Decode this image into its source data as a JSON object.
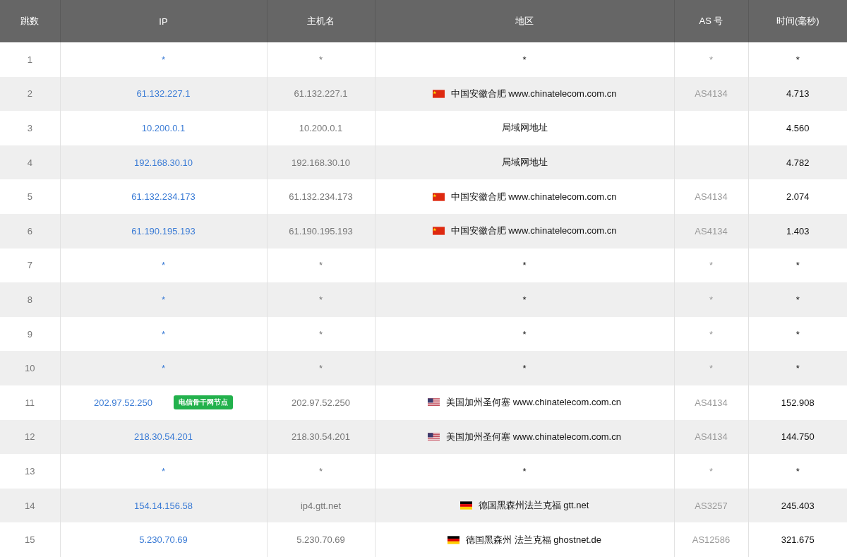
{
  "table": {
    "columns": [
      "跳数",
      "IP",
      "主机名",
      "地区",
      "AS 号",
      "时间(毫秒)"
    ],
    "rows": [
      {
        "hop": "1",
        "ip": "*",
        "host": "*",
        "region": "*",
        "as": "*",
        "time": "*"
      },
      {
        "hop": "2",
        "ip": "61.132.227.1",
        "host": "61.132.227.1",
        "kind": "cn",
        "region": "中国安徽合肥 www.chinatelecom.com.cn",
        "as": "AS4134",
        "time": "4.713"
      },
      {
        "hop": "3",
        "ip": "10.200.0.1",
        "host": "10.200.0.1",
        "region": "局域网地址",
        "time": "4.560"
      },
      {
        "hop": "4",
        "ip": "192.168.30.10",
        "host": "192.168.30.10",
        "region": "局域网地址",
        "time": "4.782"
      },
      {
        "hop": "5",
        "ip": "61.132.234.173",
        "host": "61.132.234.173",
        "kind": "cn",
        "region": "中国安徽合肥 www.chinatelecom.com.cn",
        "as": "AS4134",
        "time": "2.074"
      },
      {
        "hop": "6",
        "ip": "61.190.195.193",
        "host": "61.190.195.193",
        "kind": "cn",
        "region": "中国安徽合肥 www.chinatelecom.com.cn",
        "as": "AS4134",
        "time": "1.403"
      },
      {
        "hop": "7",
        "ip": "*",
        "host": "*",
        "region": "*",
        "as": "*",
        "time": "*"
      },
      {
        "hop": "8",
        "ip": "*",
        "host": "*",
        "region": "*",
        "as": "*",
        "time": "*"
      },
      {
        "hop": "9",
        "ip": "*",
        "host": "*",
        "region": "*",
        "as": "*",
        "time": "*"
      },
      {
        "hop": "10",
        "ip": "*",
        "host": "*",
        "region": "*",
        "as": "*",
        "time": "*"
      },
      {
        "hop": "11",
        "ip": "202.97.52.250",
        "badge": "电信骨干网节点",
        "host": "202.97.52.250",
        "kind": "us",
        "region": "美国加州圣何塞 www.chinatelecom.com.cn",
        "as": "AS4134",
        "time": "152.908"
      },
      {
        "hop": "12",
        "ip": "218.30.54.201",
        "host": "218.30.54.201",
        "kind": "us",
        "region": "美国加州圣何塞 www.chinatelecom.com.cn",
        "as": "AS4134",
        "time": "144.750"
      },
      {
        "hop": "13",
        "ip": "*",
        "host": "*",
        "region": "*",
        "as": "*",
        "time": "*"
      },
      {
        "hop": "14",
        "ip": "154.14.156.58",
        "host": "ip4.gtt.net",
        "kind": "de",
        "region": "德国黑森州法兰克福 gtt.net",
        "as": "AS3257",
        "time": "245.403"
      },
      {
        "hop": "15",
        "ip": "5.230.70.69",
        "host": "5.230.70.69",
        "kind": "de",
        "region": "德国黑森州 法兰克福 ghostnet.de",
        "as": "AS12586",
        "time": "321.675"
      }
    ]
  }
}
